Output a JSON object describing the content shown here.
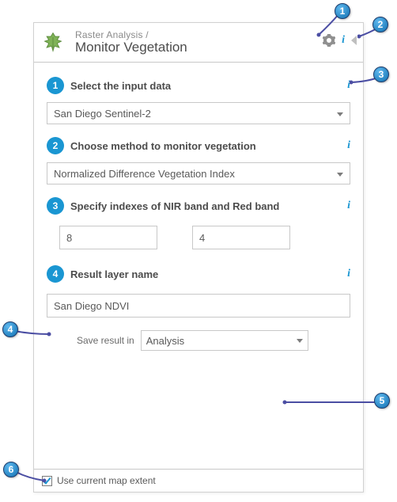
{
  "header": {
    "breadcrumb": "Raster Analysis /",
    "title": "Monitor Vegetation"
  },
  "sections": {
    "input_data": {
      "num": "1",
      "title": "Select the input data",
      "value": "San Diego Sentinel-2"
    },
    "method": {
      "num": "2",
      "title": "Choose method to monitor vegetation",
      "value": "Normalized Difference Vegetation Index"
    },
    "bands": {
      "num": "3",
      "title": "Specify indexes of NIR band and Red band",
      "nir": "8",
      "red": "4"
    },
    "result": {
      "num": "4",
      "title": "Result layer name",
      "name": "San Diego NDVI",
      "save_label": "Save result in",
      "save_value": "Analysis"
    }
  },
  "footer": {
    "extent_label": "Use current map extent",
    "extent_checked": true
  },
  "callouts": {
    "c1": "1",
    "c2": "2",
    "c3": "3",
    "c4": "4",
    "c5": "5",
    "c6": "6"
  }
}
